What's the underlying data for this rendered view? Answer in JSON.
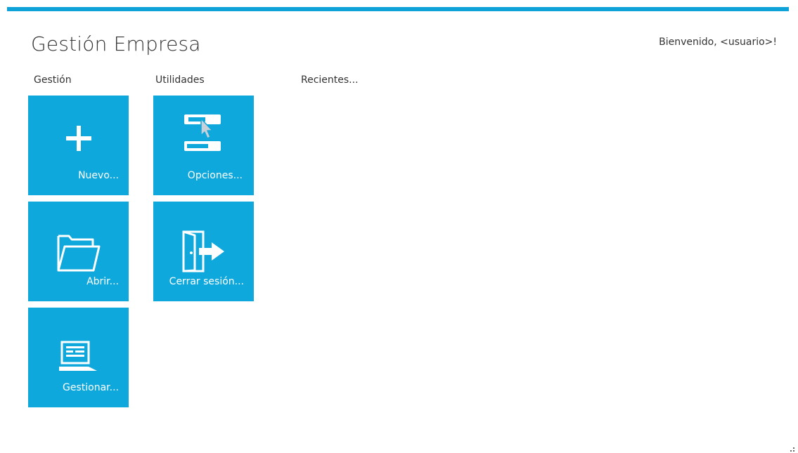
{
  "header": {
    "title": "Gestión Empresa",
    "welcome": "Bienvenido, <usuario>!"
  },
  "sections": {
    "gestion": "Gestión",
    "utilidades": "Utilidades",
    "recientes": "Recientes..."
  },
  "tiles": {
    "nuevo": {
      "label": "Nuevo...",
      "icon": "plus-icon"
    },
    "abrir": {
      "label": "Abrir...",
      "icon": "folder-open-icon"
    },
    "gestionar": {
      "label": "Gestionar...",
      "icon": "laptop-document-icon"
    },
    "opciones": {
      "label": "Opciones...",
      "icon": "options-toggle-icon"
    },
    "cerrar": {
      "label": "Cerrar sesión...",
      "icon": "logout-door-icon"
    }
  },
  "colors": {
    "accent": "#0ea8dc",
    "top_bar": "#0ea2d8",
    "tile_text": "#ffffff"
  }
}
